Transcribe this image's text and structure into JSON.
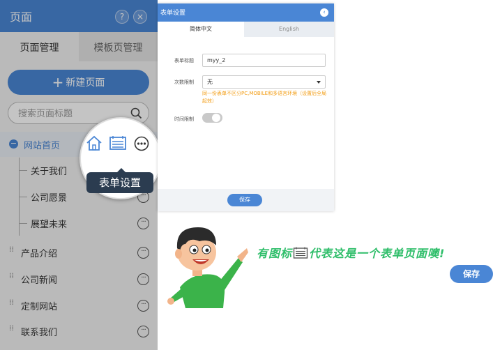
{
  "left_panel": {
    "title": "页面",
    "help_label": "?",
    "close_label": "×",
    "tabs": [
      "页面管理",
      "模板页管理"
    ],
    "new_page_button": "新建页面",
    "search_placeholder": "搜索页面标题",
    "tree": [
      {
        "label": "网站首页",
        "level": 0,
        "selected": true
      },
      {
        "label": "关于我们",
        "level": 1
      },
      {
        "label": "公司愿景",
        "level": 1
      },
      {
        "label": "展望未来",
        "level": 1
      },
      {
        "label": "产品介绍",
        "level": 0
      },
      {
        "label": "公司新闻",
        "level": 0
      },
      {
        "label": "定制网站",
        "level": 0
      },
      {
        "label": "联系我们",
        "level": 0
      }
    ]
  },
  "magnifier": {
    "tooltip": "表单设置",
    "icons": [
      "home-icon",
      "form-icon",
      "more-icon"
    ]
  },
  "dialog": {
    "title": "表单设置",
    "tabs": [
      "简体中文",
      "English"
    ],
    "form_title_label": "表单标题",
    "form_title_value": "myy_2",
    "limit_label": "次数限制",
    "limit_value": "无",
    "limit_note": "同一份表单不区分PC,MOBILE和多语言环境（设置后全局起效）",
    "time_limit_label": "时间限制",
    "save_label": "保存"
  },
  "callout": {
    "text_before": "有图标",
    "text_after": "代表这是一个表单页面噢!",
    "save_label": "保存"
  },
  "colors": {
    "accent": "#4a86d5",
    "highlight_green": "#2fbe6a",
    "note_orange": "#f39c12"
  }
}
